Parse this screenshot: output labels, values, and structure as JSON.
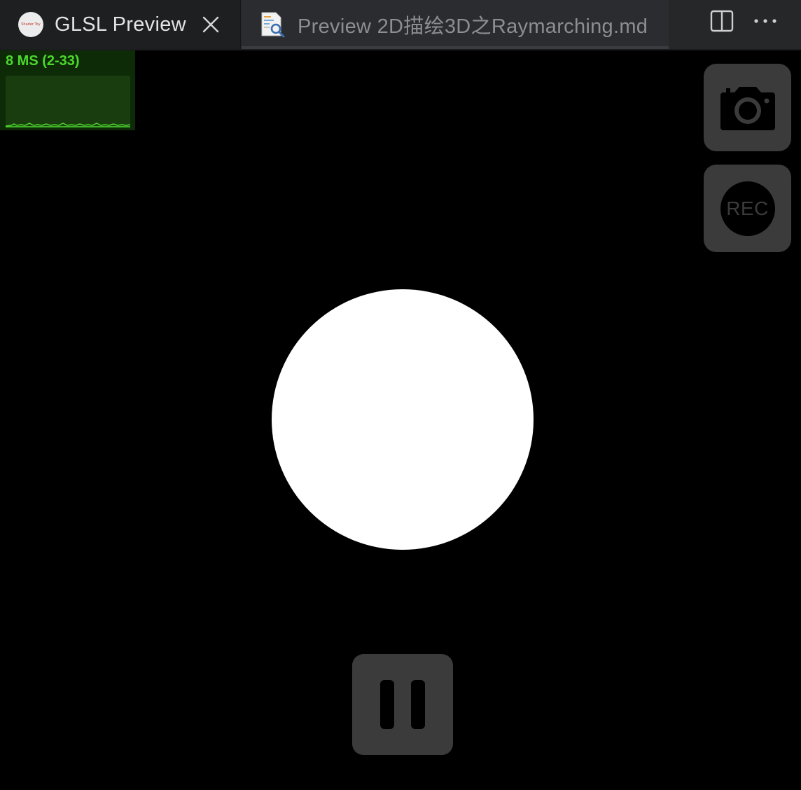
{
  "tabs": [
    {
      "title": "GLSL Preview",
      "favicon_text": "Shader Toy",
      "icon": "shader-toy-logo-icon",
      "active": true,
      "close_icon": "close-icon"
    },
    {
      "title": "Preview 2D描绘3D之Raymarching.md",
      "icon": "markdown-preview-icon",
      "active": false
    }
  ],
  "toolbar_actions": [
    {
      "name": "split-editor",
      "icon": "split-editor-icon"
    },
    {
      "name": "more-actions",
      "icon": "more-ellipsis-icon"
    }
  ],
  "stats": {
    "label": "8 MS (2-33)",
    "color": "#4cd82e",
    "graph_background": "#1a3d10"
  },
  "controls": {
    "snapshot_icon": "camera-icon",
    "record_label": "REC",
    "pause_icon": "pause-icon",
    "button_color": "#3b3b3b"
  },
  "render": {
    "shape": "circle",
    "shape_color": "#ffffff",
    "background_color": "#000000"
  }
}
